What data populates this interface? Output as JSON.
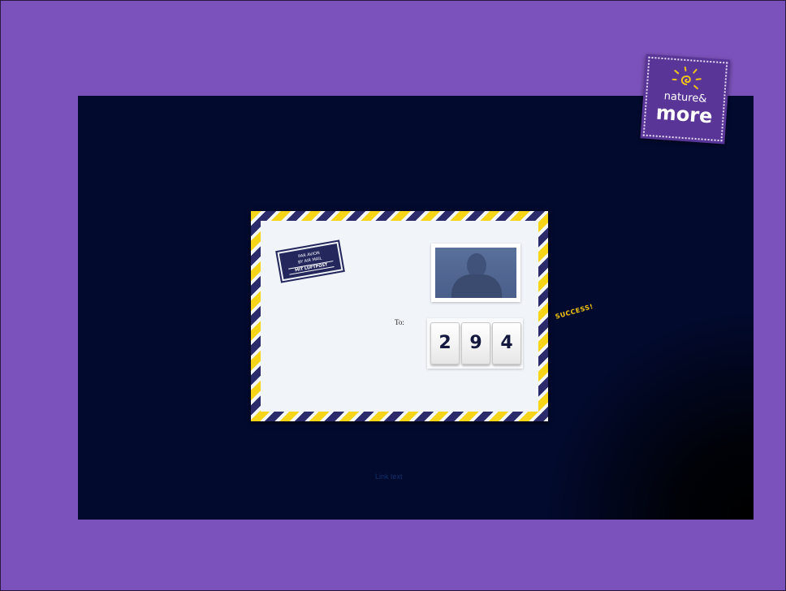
{
  "logo": {
    "line1": "nature&",
    "line2": "more"
  },
  "envelope": {
    "airmail_label": {
      "line1": "PAR AVION",
      "line2": "BY AIR MAIL",
      "line3": "MIT LUFTPOST"
    },
    "to_label": "To:",
    "counter_digits": [
      "2",
      "9",
      "4"
    ]
  },
  "status_text": "SUCCESS!",
  "bottom_link": "Link text",
  "colors": {
    "page_background": "#7b52bb",
    "stage_background": "#020a2e",
    "stripe_yellow": "#f6d417",
    "stripe_navy": "#2b2a6a",
    "logo_purple": "#5a3598",
    "success_yellow": "#f1c40f"
  }
}
